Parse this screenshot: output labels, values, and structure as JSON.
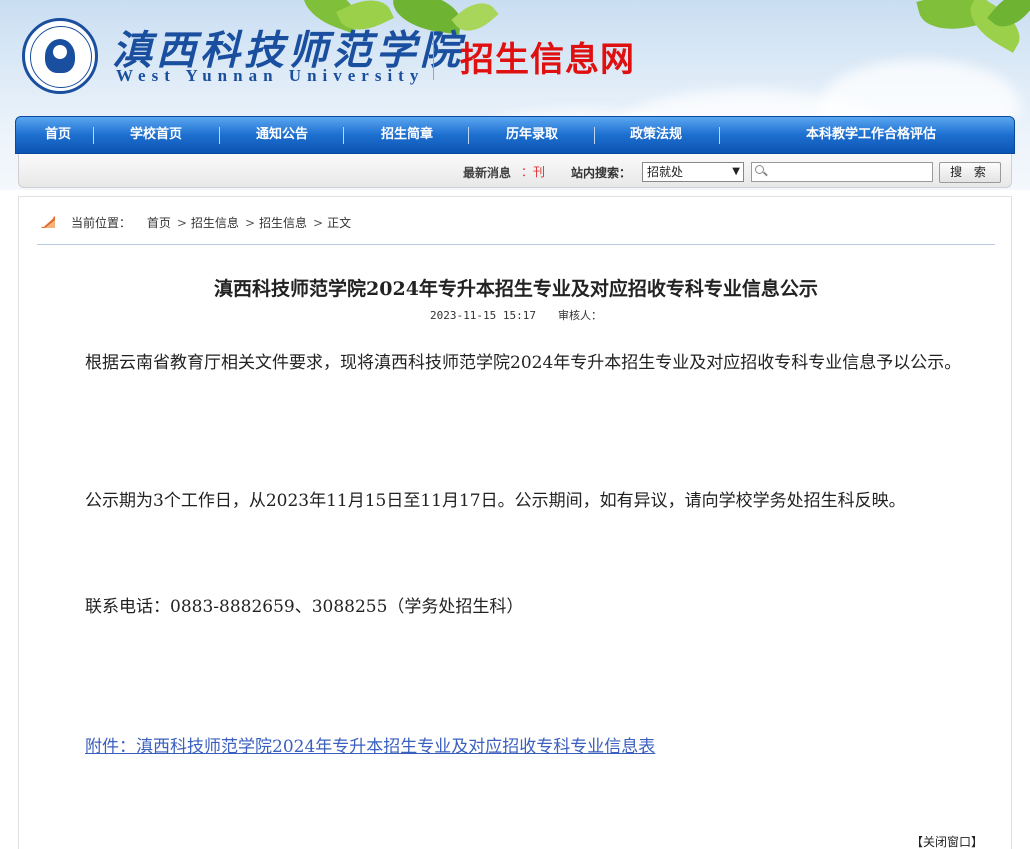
{
  "header": {
    "school_name_cn": "滇西科技师范学院",
    "school_name_en": "West  Yunnan  University",
    "site_title": "招生信息网",
    "colors": {
      "brand_blue": "#1a4fa0",
      "title_red": "#e01010"
    }
  },
  "nav": {
    "items": [
      {
        "label": "首页"
      },
      {
        "label": "学校首页"
      },
      {
        "label": "通知公告"
      },
      {
        "label": "招生简章"
      },
      {
        "label": "历年录取"
      },
      {
        "label": "政策法规"
      },
      {
        "label": "本科教学工作合格评估"
      }
    ]
  },
  "subbar": {
    "news_label": "最新消息",
    "news_marquee": "：刊",
    "search_label": "站内搜索：",
    "search_select_value": "招就处",
    "search_button": "搜 索"
  },
  "breadcrumb": {
    "label": "当前位置：",
    "items": [
      "首页",
      "招生信息",
      "招生信息",
      "正文"
    ],
    "separator": ">"
  },
  "article": {
    "title": "滇西科技师范学院2024年专升本招生专业及对应招收专科专业信息公示",
    "date": "2023-11-15 15:17",
    "reviewer_label": "审核人：",
    "paragraphs": [
      "根据云南省教育厅相关文件要求，现将滇西科技师范学院2024年专升本招生专业及对应招收专科专业信息予以公示。",
      "公示期为3个工作日，从2023年11月15日至11月17日。公示期间，如有异议，请向学校学务处招生科反映。",
      "联系电话：0883-8882659、3088255（学务处招生科）"
    ],
    "attachment": "附件：滇西科技师范学院2024年专升本招生专业及对应招收专科专业信息表",
    "close_window": "【关闭窗口】"
  }
}
